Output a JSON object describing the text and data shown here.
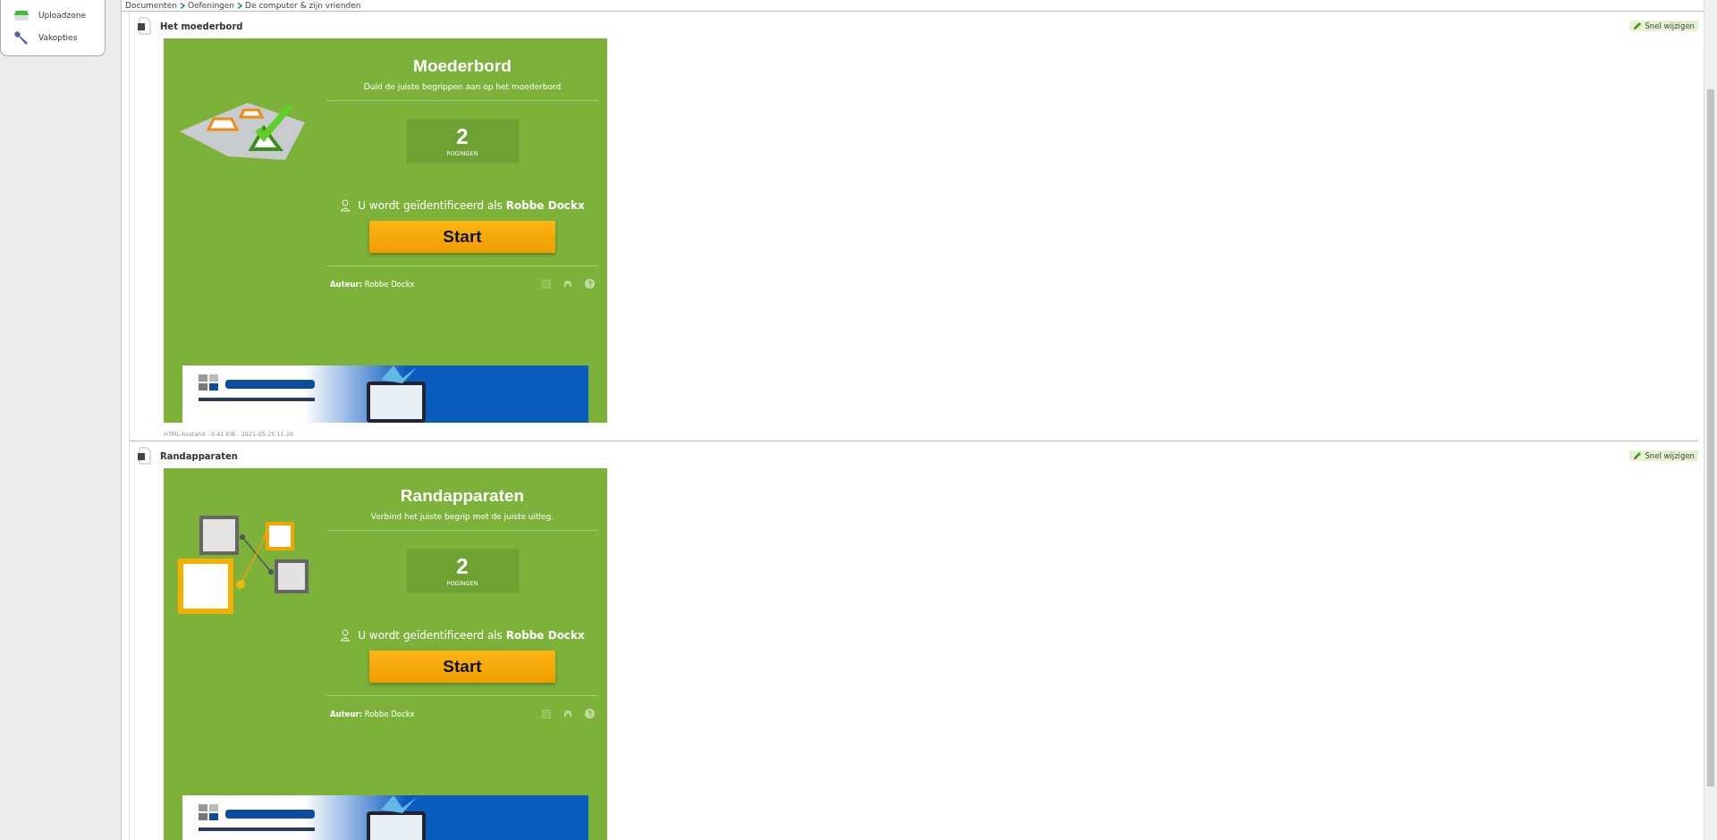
{
  "sidebar": {
    "items": [
      {
        "label": "Uploadzone",
        "kind": "upload"
      },
      {
        "label": "Vakopties",
        "kind": "tools"
      }
    ]
  },
  "breadcrumb": [
    "Documenten",
    "Oefeningen",
    "De computer & zijn vrienden"
  ],
  "documents": [
    {
      "title": "Het moederbord",
      "quick_edit": "Snel wijzigen",
      "exercise": {
        "kind": "hotspot",
        "heading": "Moederbord",
        "instruction": "Duid de juiste begrippen aan op het moederbord",
        "attempts": "2",
        "attempts_label": "POGINGEN",
        "identity": "U wordt geïdentificeerd als **Robbe Dockx**",
        "start": "Start",
        "author": "**Auteur:** Robbe Dockx"
      },
      "meta": "HTML-bestand - 0.41 KiB - 2021-05-25 11:20"
    },
    {
      "title": "Randapparaten",
      "quick_edit": "Snel wijzigen",
      "exercise": {
        "kind": "matching",
        "heading": "Randapparaten",
        "instruction": "Verbind het juiste begrip met de juiste uitleg.",
        "attempts": "2",
        "attempts_label": "POGINGEN",
        "identity": "U wordt geïdentificeerd als **Robbe Dockx**",
        "start": "Start",
        "author": "**Auteur:** Robbe Dockx"
      }
    }
  ]
}
